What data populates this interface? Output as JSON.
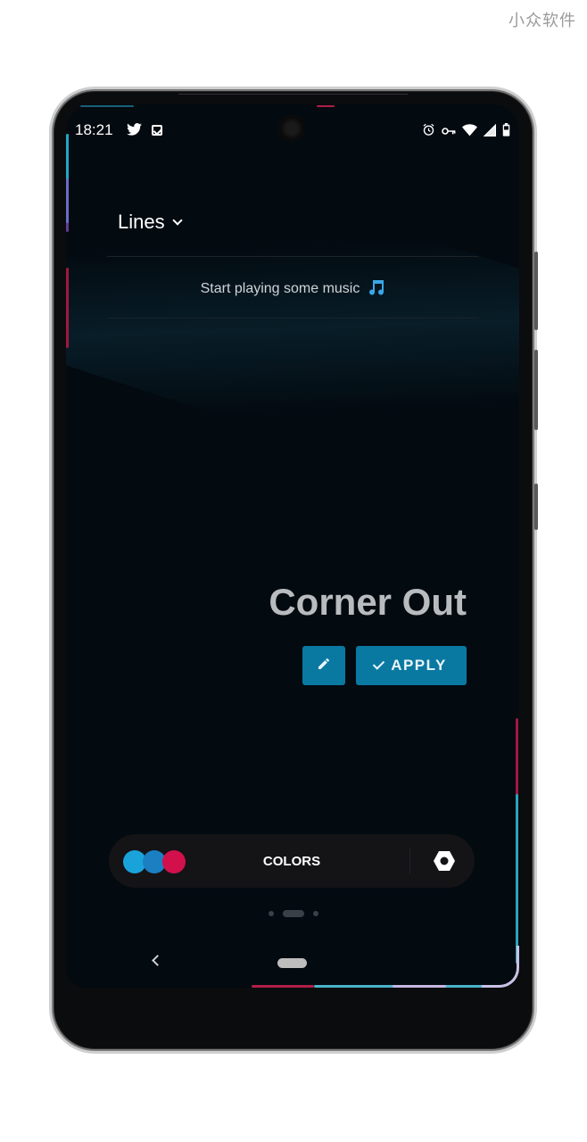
{
  "watermark": "小众软件",
  "status_bar": {
    "time": "18:21",
    "left_icons": [
      "twitter-icon",
      "checkbox-icon"
    ],
    "right_icons": [
      "alarm-icon",
      "vpn-key-icon",
      "wifi-icon",
      "signal-icon",
      "battery-icon"
    ]
  },
  "header": {
    "dropdown_label": "Lines"
  },
  "media": {
    "prompt": "Start playing some music",
    "icon": "music-note-icon"
  },
  "style": {
    "name": "Corner Out",
    "edit_icon": "pencil-icon",
    "apply_label": "APPLY"
  },
  "colors_bar": {
    "label": "COLORS",
    "swatches": [
      "#1aa3db",
      "#1b7fc2",
      "#d2114c"
    ],
    "settings_icon": "hex-nut-icon"
  },
  "pager": {
    "pages": 3,
    "current": 2
  },
  "accent_color": "#0a79a2"
}
